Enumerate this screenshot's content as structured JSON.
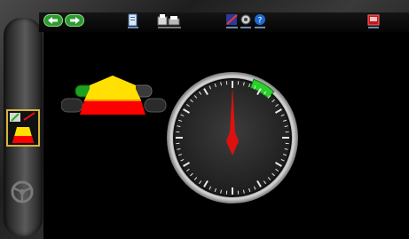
{
  "window": {
    "title": ""
  },
  "toolbar": {
    "buttons": [
      {
        "name": "back-button",
        "icon": "arrow-left-icon"
      },
      {
        "name": "forward-button",
        "icon": "arrow-right-icon"
      },
      {
        "name": "document-button",
        "icon": "document-icon"
      },
      {
        "name": "print-button",
        "icon": "printer-icon"
      },
      {
        "name": "tools-button",
        "icon": "tools-icon"
      },
      {
        "name": "settings-button",
        "icon": "settings-icon"
      },
      {
        "name": "help-button",
        "icon": "help-icon"
      },
      {
        "name": "exit-button",
        "icon": "exit-icon"
      }
    ]
  },
  "sidebar": {
    "items": [
      {
        "name": "sidebar-item-vehicle",
        "icon": "vehicle-icon",
        "selected": true
      },
      {
        "name": "sidebar-item-wheel",
        "icon": "steering-wheel-icon",
        "selected": false
      }
    ]
  },
  "gauge": {
    "needle_angle_deg": 0,
    "target_zone_start_deg": 20,
    "target_zone_end_deg": 42
  },
  "colors": {
    "accent_green": "#22b822",
    "needle_red": "#e01010",
    "vehicle_yellow": "#ffe000",
    "vehicle_red": "#ff0000",
    "selection_border": "#d6b43c"
  }
}
